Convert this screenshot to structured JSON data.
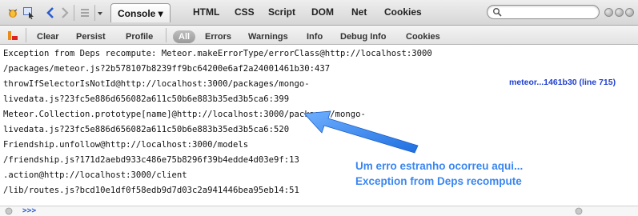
{
  "toolbar": {
    "tabs": [
      {
        "label": "HTML"
      },
      {
        "label": "CSS"
      },
      {
        "label": "Script"
      },
      {
        "label": "DOM"
      },
      {
        "label": "Net"
      },
      {
        "label": "Cookies"
      }
    ],
    "active_tab": "Console ▾",
    "search_placeholder": "",
    "icons": [
      "firebug-icon",
      "inspect-icon",
      "back-icon",
      "forward-icon",
      "command-editor-icon",
      "dropdown-icon",
      "search-icon",
      "minimize-icon",
      "detach-icon",
      "close-icon"
    ]
  },
  "filters": {
    "clear": "Clear",
    "persist": "Persist",
    "profile": "Profile",
    "all": "All",
    "errors": "Errors",
    "warnings": "Warnings",
    "info": "Info",
    "debug_info": "Debug Info",
    "cookies": "Cookies"
  },
  "console": {
    "lines": [
      "Exception from Deps recompute: Meteor.makeErrorType/errorClass@http://localhost:3000",
      "/packages/meteor.js?2b578107b8239ff9bc64200e6af2a24001461b30:437",
      "throwIfSelectorIsNotId@http://localhost:3000/packages/mongo-",
      "livedata.js?23fc5e886d656082a611c50b6e883b35ed3b5ca6:399",
      "Meteor.Collection.prototype[name]@http://localhost:3000/packages/mongo-",
      "livedata.js?23fc5e886d656082a611c50b6e883b35ed3b5ca6:520",
      "Friendship.unfollow@http://localhost:3000/models",
      "/friendship.js?171d2aebd933c486e75b8296f39b4edde4d03e9f:13",
      ".action@http://localhost:3000/client",
      "/lib/routes.js?bcd10e1df0f58edb9d7d03c2a941446bea95eb14:51"
    ],
    "source_link": "meteor...1461b30 (line 715)"
  },
  "annotation": {
    "line1": "Um erro estranho ocorreu aqui...",
    "line2": "Exception from Deps recompute"
  },
  "command_line": {
    "prompt": ">>>"
  },
  "colors": {
    "annotation": "#3a86f0",
    "link": "#1f3fcf",
    "arrow": "#2f7ae8"
  }
}
